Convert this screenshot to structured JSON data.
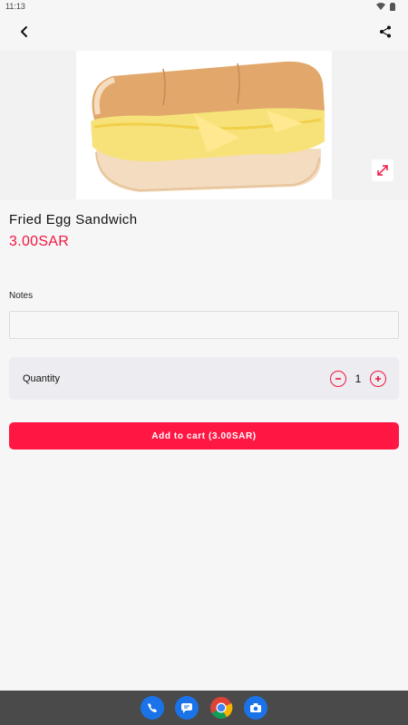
{
  "status_bar": {
    "time": "11:13"
  },
  "product": {
    "name": "Fried Egg Sandwich",
    "price": "3.00SAR"
  },
  "notes": {
    "label": "Notes",
    "value": "",
    "placeholder": ""
  },
  "quantity": {
    "label": "Quantity",
    "value": "1"
  },
  "add_to_cart": {
    "label": "Add to cart (3.00SAR)"
  },
  "colors": {
    "accent": "#ff1744",
    "price": "#f0173f"
  },
  "icons": {
    "back": "chevron-left-icon",
    "share": "share-icon",
    "expand": "expand-icon",
    "dock": [
      "phone-icon",
      "messages-icon",
      "chrome-icon",
      "camera-icon"
    ]
  }
}
